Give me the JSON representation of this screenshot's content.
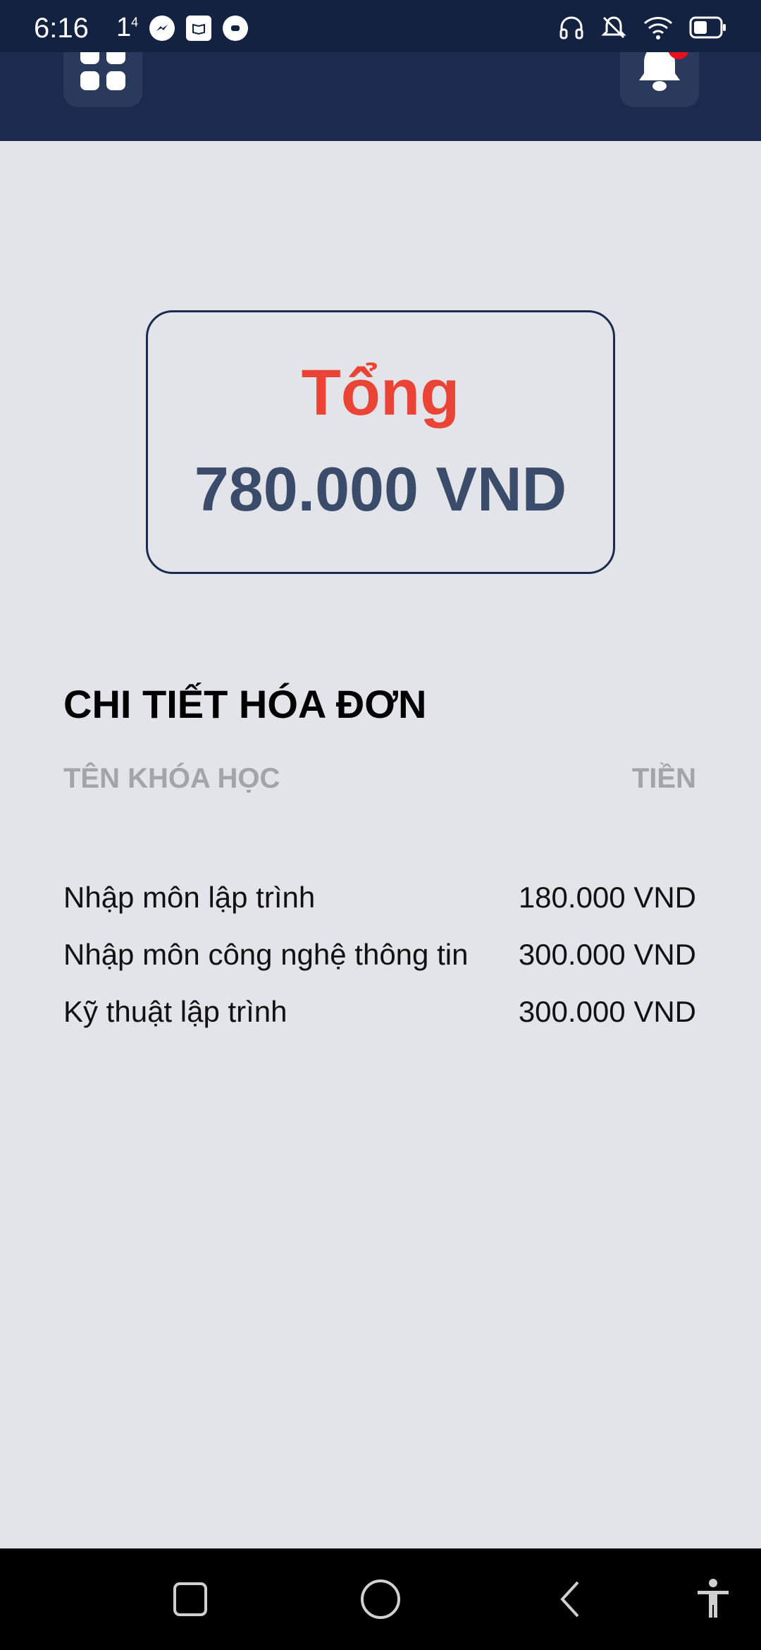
{
  "status_bar": {
    "time": "6:16",
    "extra": "1",
    "extra_sup": "4",
    "app_icons": [
      "messenger-icon",
      "book-icon",
      "chat-icon"
    ],
    "right_icons": [
      "headphones-icon",
      "bell-off-icon",
      "wifi-icon",
      "battery-icon"
    ]
  },
  "header": {
    "menu_icon": "grid-icon",
    "bell_icon": "bell-icon",
    "has_notification": true
  },
  "total": {
    "label": "Tổng",
    "value": "780.000 VND"
  },
  "invoice": {
    "title": "CHI TIẾT HÓA ĐƠN",
    "col_course": "TÊN KHÓA HỌC",
    "col_amount": "TIỀN",
    "rows": [
      {
        "name": "Nhập môn lập trình",
        "amount": "180.000 VND"
      },
      {
        "name": "Nhập môn công nghệ thông tin",
        "amount": "300.000 VND"
      },
      {
        "name": "Kỹ thuật lập trình",
        "amount": "300.000 VND"
      }
    ]
  },
  "nav": [
    "recents-square-icon",
    "home-circle-icon",
    "back-chevron-icon",
    "accessibility-icon"
  ],
  "colors": {
    "header_bg": "#1b2b4f",
    "accent_red": "#ea4436",
    "total_text": "#3b4b6a",
    "page_bg": "#e3e4e9"
  }
}
